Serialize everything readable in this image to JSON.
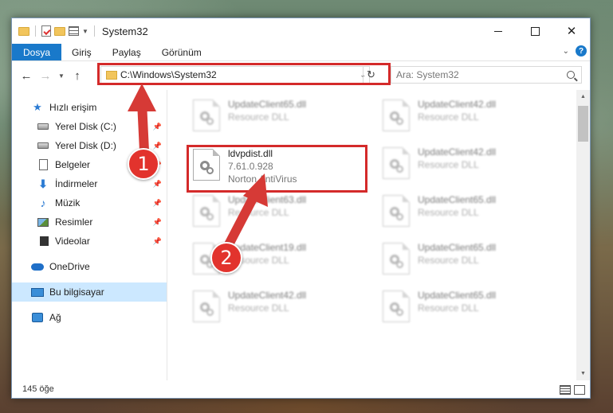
{
  "window": {
    "title": "System32"
  },
  "ribbon": {
    "tabs": [
      "Dosya",
      "Giriş",
      "Paylaş",
      "Görünüm"
    ]
  },
  "address": {
    "path": "C:\\Windows\\System32"
  },
  "search": {
    "placeholder": "Ara: System32"
  },
  "nav": {
    "quick_access": "Hızlı erişim",
    "quick_items": [
      {
        "label": "Yerel Disk (C:)",
        "icon": "drive-icon"
      },
      {
        "label": "Yerel Disk (D:)",
        "icon": "drive-icon"
      },
      {
        "label": "Belgeler",
        "icon": "documents-icon"
      },
      {
        "label": "İndirmeler",
        "icon": "downloads-icon"
      },
      {
        "label": "Müzik",
        "icon": "music-icon"
      },
      {
        "label": "Resimler",
        "icon": "pictures-icon"
      },
      {
        "label": "Videolar",
        "icon": "videos-icon"
      }
    ],
    "onedrive": "OneDrive",
    "this_pc": "Bu bilgisayar",
    "network": "Ağ"
  },
  "files": {
    "highlighted": {
      "name": "ldvpdist.dll",
      "version": "7.61.0.928",
      "company": "Norton AntiVirus"
    },
    "left_column": [
      {
        "name": "UpdateClient65.dll",
        "desc": "Resource DLL"
      },
      {
        "name": "UpdateClient63.dll",
        "desc": "Resource DLL"
      },
      {
        "name": "UpdateClient19.dll",
        "desc": "Resource DLL"
      },
      {
        "name": "UpdateClient42.dll",
        "desc": "Resource DLL"
      }
    ],
    "right_column": [
      {
        "name": "UpdateClient42.dll",
        "desc": "Resource DLL"
      },
      {
        "name": "UpdateClient42.dll",
        "desc": "Resource DLL"
      },
      {
        "name": "UpdateClient65.dll",
        "desc": "Resource DLL"
      },
      {
        "name": "UpdateClient65.dll",
        "desc": "Resource DLL"
      },
      {
        "name": "UpdateClient65.dll",
        "desc": "Resource DLL"
      }
    ]
  },
  "status": {
    "count": "145 öğe"
  },
  "annotations": {
    "step1": "1",
    "step2": "2"
  },
  "colors": {
    "accent": "#1979ca",
    "highlight": "#d42a2a",
    "selected": "#cce8ff"
  }
}
